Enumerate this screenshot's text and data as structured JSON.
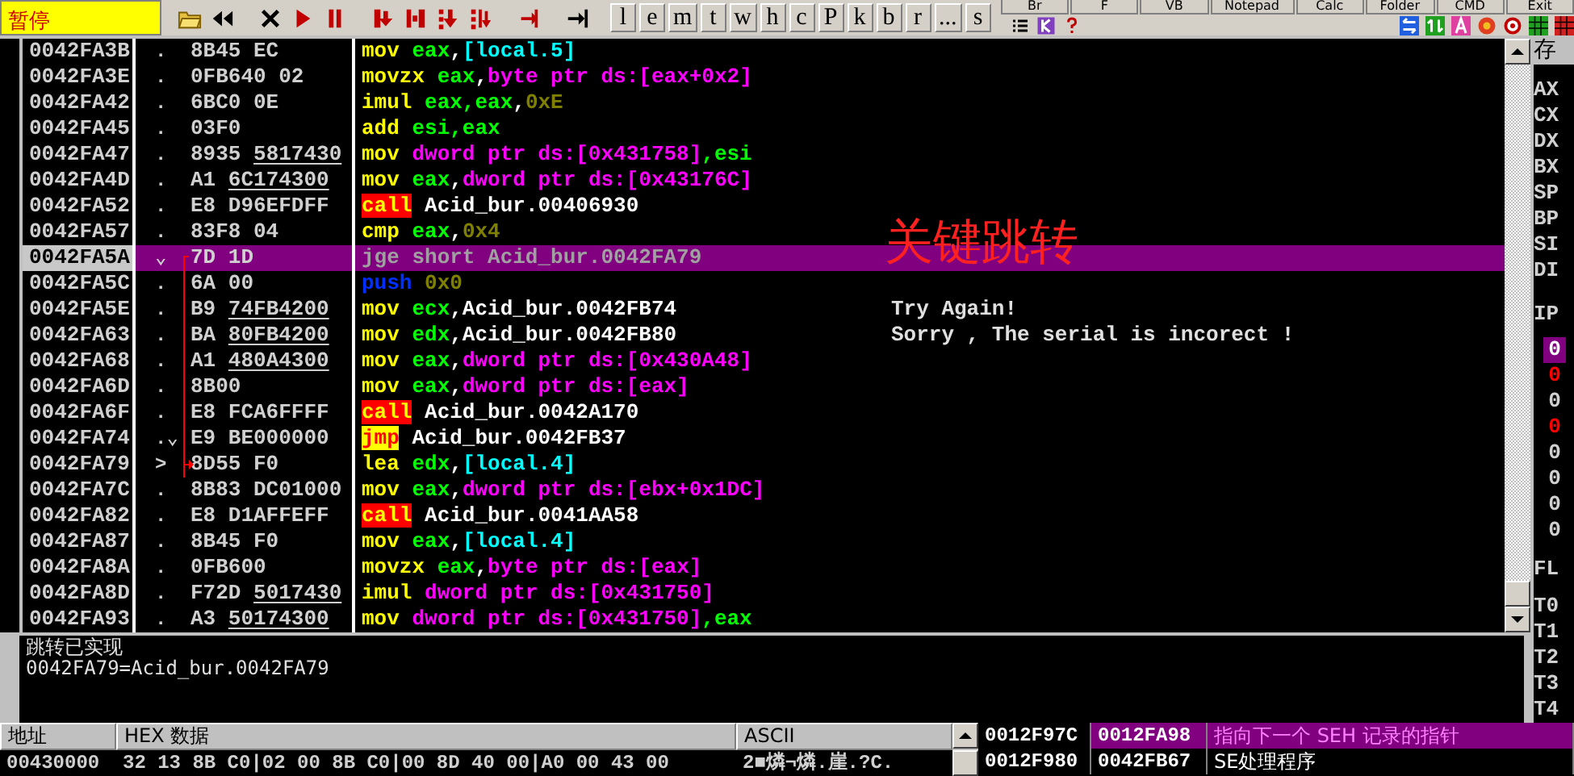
{
  "toolbar": {
    "status": "暂停",
    "letter_buttons": [
      "l",
      "e",
      "m",
      "t",
      "w",
      "h",
      "c",
      "P",
      "k",
      "b",
      "r",
      "...",
      "s"
    ],
    "plugin_buttons": [
      "Br",
      "F",
      "VB",
      "Notepad",
      "Calc",
      "Folder",
      "CMD",
      "Exit"
    ]
  },
  "disassembly": {
    "rows": [
      {
        "address": "0042FA3B",
        "marker": ".",
        "bytes": "8B45 EC",
        "mnemonic": {
          "kind": "plain",
          "text": "mov"
        },
        "operands": [
          {
            "kind": "reg",
            "text": "eax"
          },
          {
            "kind": "sep",
            "text": ","
          },
          {
            "kind": "local",
            "text": "[local.5]"
          }
        ],
        "selected": false,
        "jump_source": false,
        "jump_target": false
      },
      {
        "address": "0042FA3E",
        "marker": ".",
        "bytes": "0FB640 02",
        "mnemonic": {
          "kind": "plain",
          "text": "movzx"
        },
        "operands": [
          {
            "kind": "reg",
            "text": "eax"
          },
          {
            "kind": "sep",
            "text": ","
          },
          {
            "kind": "mem",
            "text": "byte ptr ds:[eax+0x2]"
          }
        ],
        "selected": false,
        "jump_source": false,
        "jump_target": false
      },
      {
        "address": "0042FA42",
        "marker": ".",
        "bytes": "6BC0 0E",
        "mnemonic": {
          "kind": "plain",
          "text": "imul"
        },
        "operands": [
          {
            "kind": "reg",
            "text": "eax,eax"
          },
          {
            "kind": "sep",
            "text": ","
          },
          {
            "kind": "imm",
            "text": "0xE"
          }
        ],
        "selected": false,
        "jump_source": false,
        "jump_target": false
      },
      {
        "address": "0042FA45",
        "marker": ".",
        "bytes": "03F0",
        "mnemonic": {
          "kind": "plain",
          "text": "add"
        },
        "operands": [
          {
            "kind": "reg",
            "text": "esi,eax"
          }
        ],
        "selected": false,
        "jump_source": false,
        "jump_target": false
      },
      {
        "address": "0042FA47",
        "marker": ".",
        "bytes": "8935",
        "fixup": "5817430",
        "mnemonic": {
          "kind": "plain",
          "text": "mov"
        },
        "operands": [
          {
            "kind": "mem",
            "text": "dword ptr ds:[0x431758]"
          },
          {
            "kind": "reg",
            "text": ",esi"
          }
        ],
        "selected": false,
        "jump_source": false,
        "jump_target": false
      },
      {
        "address": "0042FA4D",
        "marker": ".",
        "bytes": "A1",
        "fixup": "6C174300",
        "mnemonic": {
          "kind": "plain",
          "text": "mov"
        },
        "operands": [
          {
            "kind": "reg",
            "text": "eax"
          },
          {
            "kind": "sep",
            "text": ","
          },
          {
            "kind": "mem",
            "text": "dword ptr ds:[0x43176C]"
          }
        ],
        "selected": false,
        "jump_source": false,
        "jump_target": false
      },
      {
        "address": "0042FA52",
        "marker": ".",
        "bytes": "E8 D96EFDFF",
        "mnemonic": {
          "kind": "call",
          "text": "call"
        },
        "operands": [
          {
            "kind": "sym",
            "text": "Acid_bur.00406930"
          }
        ],
        "selected": false,
        "jump_source": false,
        "jump_target": false
      },
      {
        "address": "0042FA57",
        "marker": ".",
        "bytes": "83F8 04",
        "mnemonic": {
          "kind": "plain",
          "text": "cmp"
        },
        "operands": [
          {
            "kind": "reg",
            "text": "eax"
          },
          {
            "kind": "sep",
            "text": ","
          },
          {
            "kind": "imm",
            "text": "0x4"
          }
        ],
        "selected": false,
        "jump_source": false,
        "jump_target": false
      },
      {
        "address": "0042FA5A",
        "marker": "⌄",
        "bytes": "7D 1D",
        "mnemonic": {
          "kind": "plain",
          "text": "jge"
        },
        "operands": [
          {
            "kind": "sym",
            "text": "short Acid_bur.0042FA79"
          }
        ],
        "selected": true,
        "jump_source": true,
        "jump_target": false,
        "annotation": "关键跳转"
      },
      {
        "address": "0042FA5C",
        "marker": ".",
        "bytes": "6A 00",
        "mnemonic": {
          "kind": "push",
          "text": "push"
        },
        "operands": [
          {
            "kind": "imm",
            "text": "0x0"
          }
        ],
        "selected": false,
        "jump_source": false,
        "jump_target": false
      },
      {
        "address": "0042FA5E",
        "marker": ".",
        "bytes": "B9",
        "fixup": "74FB4200",
        "mnemonic": {
          "kind": "plain",
          "text": "mov"
        },
        "operands": [
          {
            "kind": "reg",
            "text": "ecx"
          },
          {
            "kind": "sym",
            "text": ",Acid_bur.0042FB74"
          }
        ],
        "selected": false,
        "jump_source": false,
        "jump_target": false,
        "comment": "Try Again!"
      },
      {
        "address": "0042FA63",
        "marker": ".",
        "bytes": "BA",
        "fixup": "80FB4200",
        "mnemonic": {
          "kind": "plain",
          "text": "mov"
        },
        "operands": [
          {
            "kind": "reg",
            "text": "edx"
          },
          {
            "kind": "sym",
            "text": ",Acid_bur.0042FB80"
          }
        ],
        "selected": false,
        "jump_source": false,
        "jump_target": false,
        "comment": "Sorry , The serial is incorect !"
      },
      {
        "address": "0042FA68",
        "marker": ".",
        "bytes": "A1",
        "fixup": "480A4300",
        "mnemonic": {
          "kind": "plain",
          "text": "mov"
        },
        "operands": [
          {
            "kind": "reg",
            "text": "eax"
          },
          {
            "kind": "sep",
            "text": ","
          },
          {
            "kind": "mem",
            "text": "dword ptr ds:[0x430A48]"
          }
        ],
        "selected": false,
        "jump_source": false,
        "jump_target": false
      },
      {
        "address": "0042FA6D",
        "marker": ".",
        "bytes": "8B00",
        "mnemonic": {
          "kind": "plain",
          "text": "mov"
        },
        "operands": [
          {
            "kind": "reg",
            "text": "eax"
          },
          {
            "kind": "sep",
            "text": ","
          },
          {
            "kind": "mem",
            "text": "dword ptr ds:[eax]"
          }
        ],
        "selected": false,
        "jump_source": false,
        "jump_target": false
      },
      {
        "address": "0042FA6F",
        "marker": ".",
        "bytes": "E8 FCA6FFFF",
        "mnemonic": {
          "kind": "call",
          "text": "call"
        },
        "operands": [
          {
            "kind": "sym",
            "text": "Acid_bur.0042A170"
          }
        ],
        "selected": false,
        "jump_source": false,
        "jump_target": false
      },
      {
        "address": "0042FA74",
        "marker": ".⌄",
        "bytes": "E9 BE000000",
        "mnemonic": {
          "kind": "jmp",
          "text": "jmp"
        },
        "operands": [
          {
            "kind": "sym",
            "text": "Acid_bur.0042FB37"
          }
        ],
        "selected": false,
        "jump_source": false,
        "jump_target": false
      },
      {
        "address": "0042FA79",
        "marker": ">",
        "bytes": "8D55 F0",
        "mnemonic": {
          "kind": "plain",
          "text": "lea"
        },
        "operands": [
          {
            "kind": "reg",
            "text": "edx"
          },
          {
            "kind": "sep",
            "text": ","
          },
          {
            "kind": "local",
            "text": "[local.4]"
          }
        ],
        "selected": false,
        "jump_source": false,
        "jump_target": true
      },
      {
        "address": "0042FA7C",
        "marker": ".",
        "bytes": "8B83 DC01000",
        "mnemonic": {
          "kind": "plain",
          "text": "mov"
        },
        "operands": [
          {
            "kind": "reg",
            "text": "eax"
          },
          {
            "kind": "sep",
            "text": ","
          },
          {
            "kind": "mem",
            "text": "dword ptr ds:[ebx+0x1DC]"
          }
        ],
        "selected": false,
        "jump_source": false,
        "jump_target": false
      },
      {
        "address": "0042FA82",
        "marker": ".",
        "bytes": "E8 D1AFFEFF",
        "mnemonic": {
          "kind": "call",
          "text": "call"
        },
        "operands": [
          {
            "kind": "sym",
            "text": "Acid_bur.0041AA58"
          }
        ],
        "selected": false,
        "jump_source": false,
        "jump_target": false
      },
      {
        "address": "0042FA87",
        "marker": ".",
        "bytes": "8B45 F0",
        "mnemonic": {
          "kind": "plain",
          "text": "mov"
        },
        "operands": [
          {
            "kind": "reg",
            "text": "eax"
          },
          {
            "kind": "sep",
            "text": ","
          },
          {
            "kind": "local",
            "text": "[local.4]"
          }
        ],
        "selected": false,
        "jump_source": false,
        "jump_target": false
      },
      {
        "address": "0042FA8A",
        "marker": ".",
        "bytes": "0FB600",
        "mnemonic": {
          "kind": "plain",
          "text": "movzx"
        },
        "operands": [
          {
            "kind": "reg",
            "text": "eax"
          },
          {
            "kind": "sep",
            "text": ","
          },
          {
            "kind": "mem",
            "text": "byte ptr ds:[eax]"
          }
        ],
        "selected": false,
        "jump_source": false,
        "jump_target": false
      },
      {
        "address": "0042FA8D",
        "marker": ".",
        "bytes": "F72D",
        "fixup": "5017430",
        "mnemonic": {
          "kind": "plain",
          "text": "imul"
        },
        "operands": [
          {
            "kind": "mem",
            "text": "dword ptr ds:[0x431750]"
          }
        ],
        "selected": false,
        "jump_source": false,
        "jump_target": false
      },
      {
        "address": "0042FA93",
        "marker": ".",
        "bytes": "A3",
        "fixup": "50174300",
        "mnemonic": {
          "kind": "plain",
          "text": "mov"
        },
        "operands": [
          {
            "kind": "mem",
            "text": "dword ptr ds:[0x431750]"
          },
          {
            "kind": "reg",
            "text": ",eax"
          }
        ],
        "selected": false,
        "jump_source": false,
        "jump_target": false
      }
    ]
  },
  "info_pane": {
    "lines": [
      "跳转已实现",
      "0042FA79=Acid_bur.0042FA79"
    ]
  },
  "registers": {
    "title": "存",
    "names": [
      "AX",
      "CX",
      "DX",
      "BX",
      "SP",
      "BP",
      "SI",
      "DI"
    ],
    "ip": "IP",
    "flags": [
      {
        "value": "0",
        "selected": true,
        "changed": false
      },
      {
        "value": "0",
        "selected": false,
        "changed": true
      },
      {
        "value": "0",
        "selected": false,
        "changed": false
      },
      {
        "value": "0",
        "selected": false,
        "changed": true
      },
      {
        "value": "0",
        "selected": false,
        "changed": false
      },
      {
        "value": "0",
        "selected": false,
        "changed": false
      },
      {
        "value": "0",
        "selected": false,
        "changed": false
      },
      {
        "value": "0",
        "selected": false,
        "changed": false
      }
    ],
    "fl": "FL",
    "fpu": [
      "T0",
      "T1",
      "T2",
      "T3",
      "T4"
    ]
  },
  "dump": {
    "columns": [
      "地址",
      "HEX 数据",
      "ASCII"
    ],
    "rows": [
      {
        "address": "00430000",
        "hex": "32 13 8B C0|02 00 8B C0|00 8D 40 00|A0 00 43 00",
        "ascii": "2■燐¬燐.崖.?C."
      }
    ]
  },
  "stack": {
    "rows": [
      {
        "address": "0012F97C",
        "value": "0012FA98",
        "comment": "指向下一个 SEH 记录的指针",
        "selected": true
      },
      {
        "address": "0012F980",
        "value": "0042FB67",
        "comment": "SE处理程序",
        "selected": false
      }
    ]
  }
}
